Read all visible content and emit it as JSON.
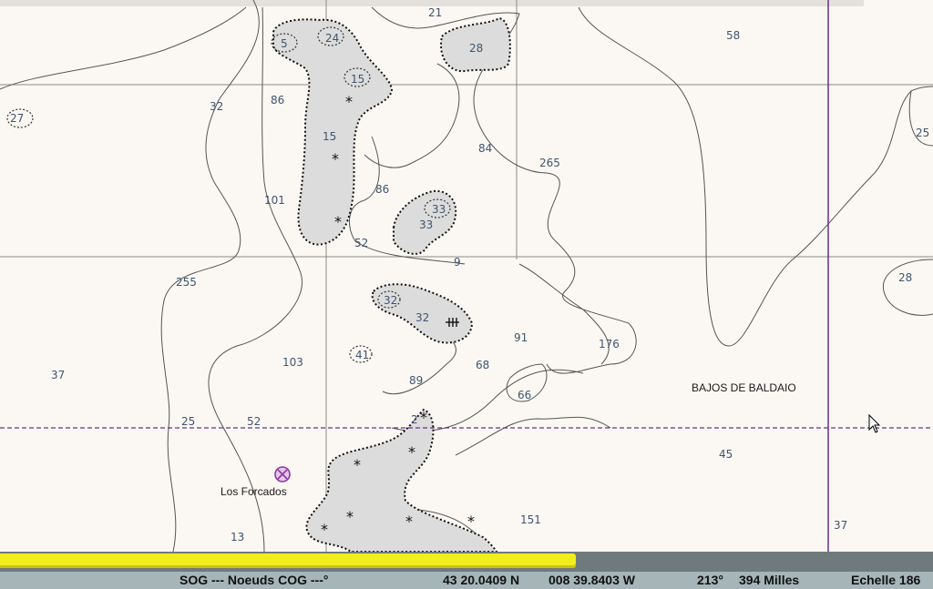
{
  "chart": {
    "area_name": "BAJOS DE BALDAIO",
    "place_name": "Los Forcados",
    "soundings": [
      {
        "id": "s21",
        "label": "21"
      },
      {
        "id": "s58",
        "label": "58"
      },
      {
        "id": "s5a",
        "label": "5"
      },
      {
        "id": "s24",
        "label": "24"
      },
      {
        "id": "s28a",
        "label": "28"
      },
      {
        "id": "s15a",
        "label": "15"
      },
      {
        "id": "s86a",
        "label": "86"
      },
      {
        "id": "s32a",
        "label": "32"
      },
      {
        "id": "s27",
        "label": "27"
      },
      {
        "id": "s25a",
        "label": "25"
      },
      {
        "id": "s15b",
        "label": "15"
      },
      {
        "id": "s84",
        "label": "84"
      },
      {
        "id": "s265",
        "label": "265"
      },
      {
        "id": "s101",
        "label": "101"
      },
      {
        "id": "s86b",
        "label": "86"
      },
      {
        "id": "s33a",
        "label": "33"
      },
      {
        "id": "s33b",
        "label": "33"
      },
      {
        "id": "s52a",
        "label": "52"
      },
      {
        "id": "s9",
        "label": "9"
      },
      {
        "id": "s255",
        "label": "255"
      },
      {
        "id": "s28b",
        "label": "28"
      },
      {
        "id": "s32b",
        "label": "32"
      },
      {
        "id": "s32c",
        "label": "32"
      },
      {
        "id": "s91",
        "label": "91"
      },
      {
        "id": "s176",
        "label": "176"
      },
      {
        "id": "s41",
        "label": "41"
      },
      {
        "id": "s103",
        "label": "103"
      },
      {
        "id": "s37a",
        "label": "37"
      },
      {
        "id": "s89",
        "label": "89"
      },
      {
        "id": "s68",
        "label": "68"
      },
      {
        "id": "s66",
        "label": "66"
      },
      {
        "id": "s25b",
        "label": "25"
      },
      {
        "id": "s52b",
        "label": "52"
      },
      {
        "id": "s2",
        "label": "2"
      },
      {
        "id": "s45",
        "label": "45"
      },
      {
        "id": "s13",
        "label": "13"
      },
      {
        "id": "s151",
        "label": "151"
      },
      {
        "id": "s37b",
        "label": "37"
      }
    ],
    "colors": {
      "land": "#fbf8f3",
      "shoal": "#dcdcdc",
      "contour": "#555555",
      "grid": "#8a8a8a",
      "route": "#6b2e8a",
      "sounding": "#3f5570"
    }
  },
  "progress": {
    "fraction": 0.617
  },
  "status": {
    "sog": "SOG --- Noeuds COG ---°",
    "latitude": "43 20.0409 N",
    "longitude": "008 39.8403 W",
    "bearing": "213°",
    "distance": "394 Milles",
    "scale": "Echelle 186"
  }
}
